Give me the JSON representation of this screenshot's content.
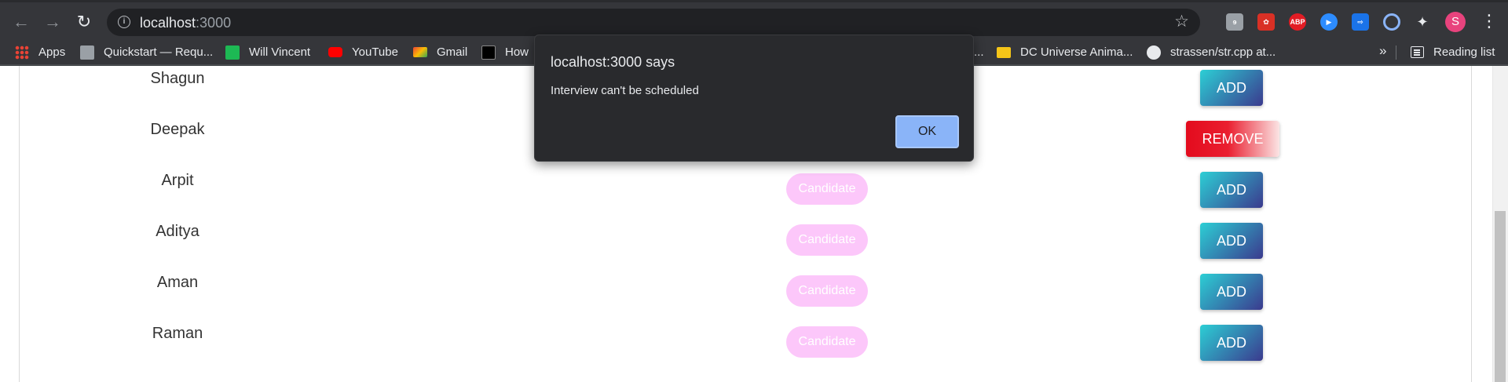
{
  "browser": {
    "url_host": "localhost",
    "url_port": ":3000",
    "profile_initial": "S",
    "extensions": [
      {
        "name": "evernote-ext-icon",
        "label": "",
        "color": "#9aa0a6"
      },
      {
        "name": "paw-ext-icon",
        "label": "",
        "color": "#d93025"
      },
      {
        "name": "adblock-plus-icon",
        "label": "ABP",
        "color": "#e21c24"
      },
      {
        "name": "zoom-ext-icon",
        "label": "",
        "color": "#2d8cff"
      },
      {
        "name": "cast-ext-icon",
        "label": "",
        "color": "#1a73e8"
      },
      {
        "name": "ring-ext-icon",
        "label": "",
        "color": "#8ab4f8"
      }
    ]
  },
  "bookmarks": {
    "items": [
      {
        "label": "Apps"
      },
      {
        "label": "Quickstart — Requ..."
      },
      {
        "label": "Will Vincent"
      },
      {
        "label": "YouTube"
      },
      {
        "label": "Gmail"
      },
      {
        "label": "How"
      },
      {
        "label": "..."
      },
      {
        "label": "DC Universe Anima..."
      },
      {
        "label": "strassen/str.cpp at..."
      }
    ],
    "overflow": "»",
    "reading_list": "Reading list"
  },
  "table": {
    "rows": [
      {
        "name": "Shagun",
        "role": "",
        "action": "ADD"
      },
      {
        "name": "Deepak",
        "role": "",
        "action": "REMOVE"
      },
      {
        "name": "Arpit",
        "role": "Candidate",
        "action": "ADD"
      },
      {
        "name": "Aditya",
        "role": "Candidate",
        "action": "ADD"
      },
      {
        "name": "Aman",
        "role": "Candidate",
        "action": "ADD"
      },
      {
        "name": "Raman",
        "role": "Candidate",
        "action": "ADD"
      }
    ]
  },
  "dialog": {
    "title": "localhost:3000 says",
    "message": "Interview can't be scheduled",
    "ok_label": "OK"
  }
}
